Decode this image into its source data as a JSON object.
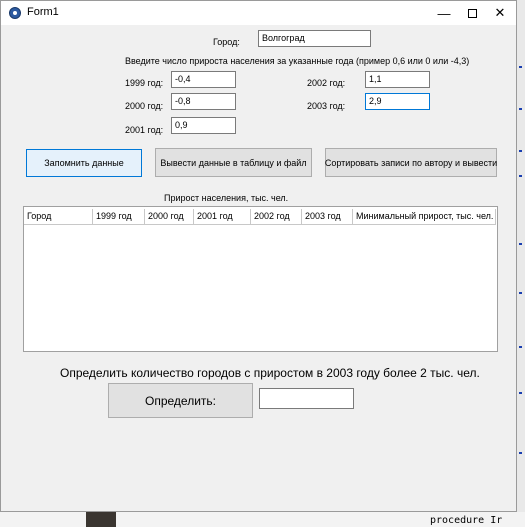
{
  "window": {
    "title": "Form1",
    "controls": {
      "minimize": "—",
      "close": "✕"
    }
  },
  "form": {
    "city_label": "Город:",
    "city_value": "Волгоград",
    "instruction": "Введите число прироста населения за указанные года (пример 0,6 или 0 или -4,3)",
    "years": [
      {
        "label": "1999 год:",
        "value": "-0,4"
      },
      {
        "label": "2000 год:",
        "value": "-0,8"
      },
      {
        "label": "2001 год:",
        "value": "0,9"
      },
      {
        "label": "2002 год:",
        "value": "1,1"
      },
      {
        "label": "2003 год:",
        "value": "2,9"
      }
    ]
  },
  "buttons": {
    "save": "Запомнить данные",
    "output": "Вывести данные в таблицу и файл",
    "sort": "Сортировать записи по автору и вывести",
    "determine": "Определить:"
  },
  "table": {
    "caption": "Прирост населения, тыс. чел.",
    "columns": [
      "Город",
      "1999 год",
      "2000 год",
      "2001 год",
      "2002 год",
      "2003 год",
      "Минимальный прирост, тыс. чел."
    ],
    "rows": []
  },
  "query": {
    "text": "Определить количество городов с приростом в 2003 году более 2 тыс. чел.",
    "result": ""
  },
  "background": {
    "code_text": "procedure Ir"
  }
}
